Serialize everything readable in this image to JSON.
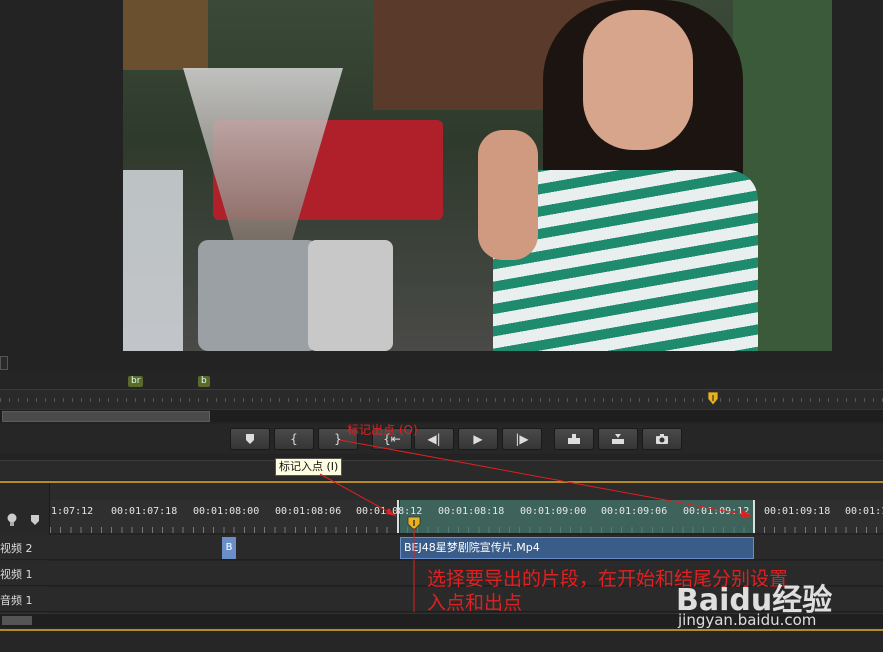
{
  "markers": {
    "mini_1": "br",
    "mini_2": "b"
  },
  "transport": {
    "marker_icon": "marker-icon",
    "mark_in": "{",
    "mark_out": "}",
    "go_to_in": "{⇤",
    "step_back": "◀|",
    "play": "▶",
    "step_forward": "|▶",
    "insert": "insert-icon",
    "overwrite": "overwrite-icon",
    "export_frame": "camera-icon"
  },
  "tooltip": "标记入点 (I)",
  "timecodes": [
    "1:07:12",
    "00:01:07:18",
    "00:01:08:00",
    "00:01:08:06",
    "00:01:08:12",
    "00:01:08:18",
    "00:01:09:00",
    "00:01:09:06",
    "00:01:09:12",
    "00:01:09:18",
    "00:01:1"
  ],
  "tracks": {
    "video2": "视频 2",
    "video1": "视频 1",
    "audio1": "音频 1"
  },
  "clips": {
    "small_b": "B",
    "main": "BEJ48星梦剧院宣传片.Mp4"
  },
  "annotations": {
    "out_label": "标记出点 (O)",
    "main_line1": "选择要导出的片段，在开始和结尾分别设置",
    "main_line2": "入点和出点"
  },
  "watermark": {
    "logo": "Baidu经验",
    "url": "jingyan.baidu.com"
  },
  "colors": {
    "accent_red": "#e02020",
    "inout_range": "#46807380",
    "clip_blue": "#3a5c88",
    "gold": "#b58b2a"
  }
}
